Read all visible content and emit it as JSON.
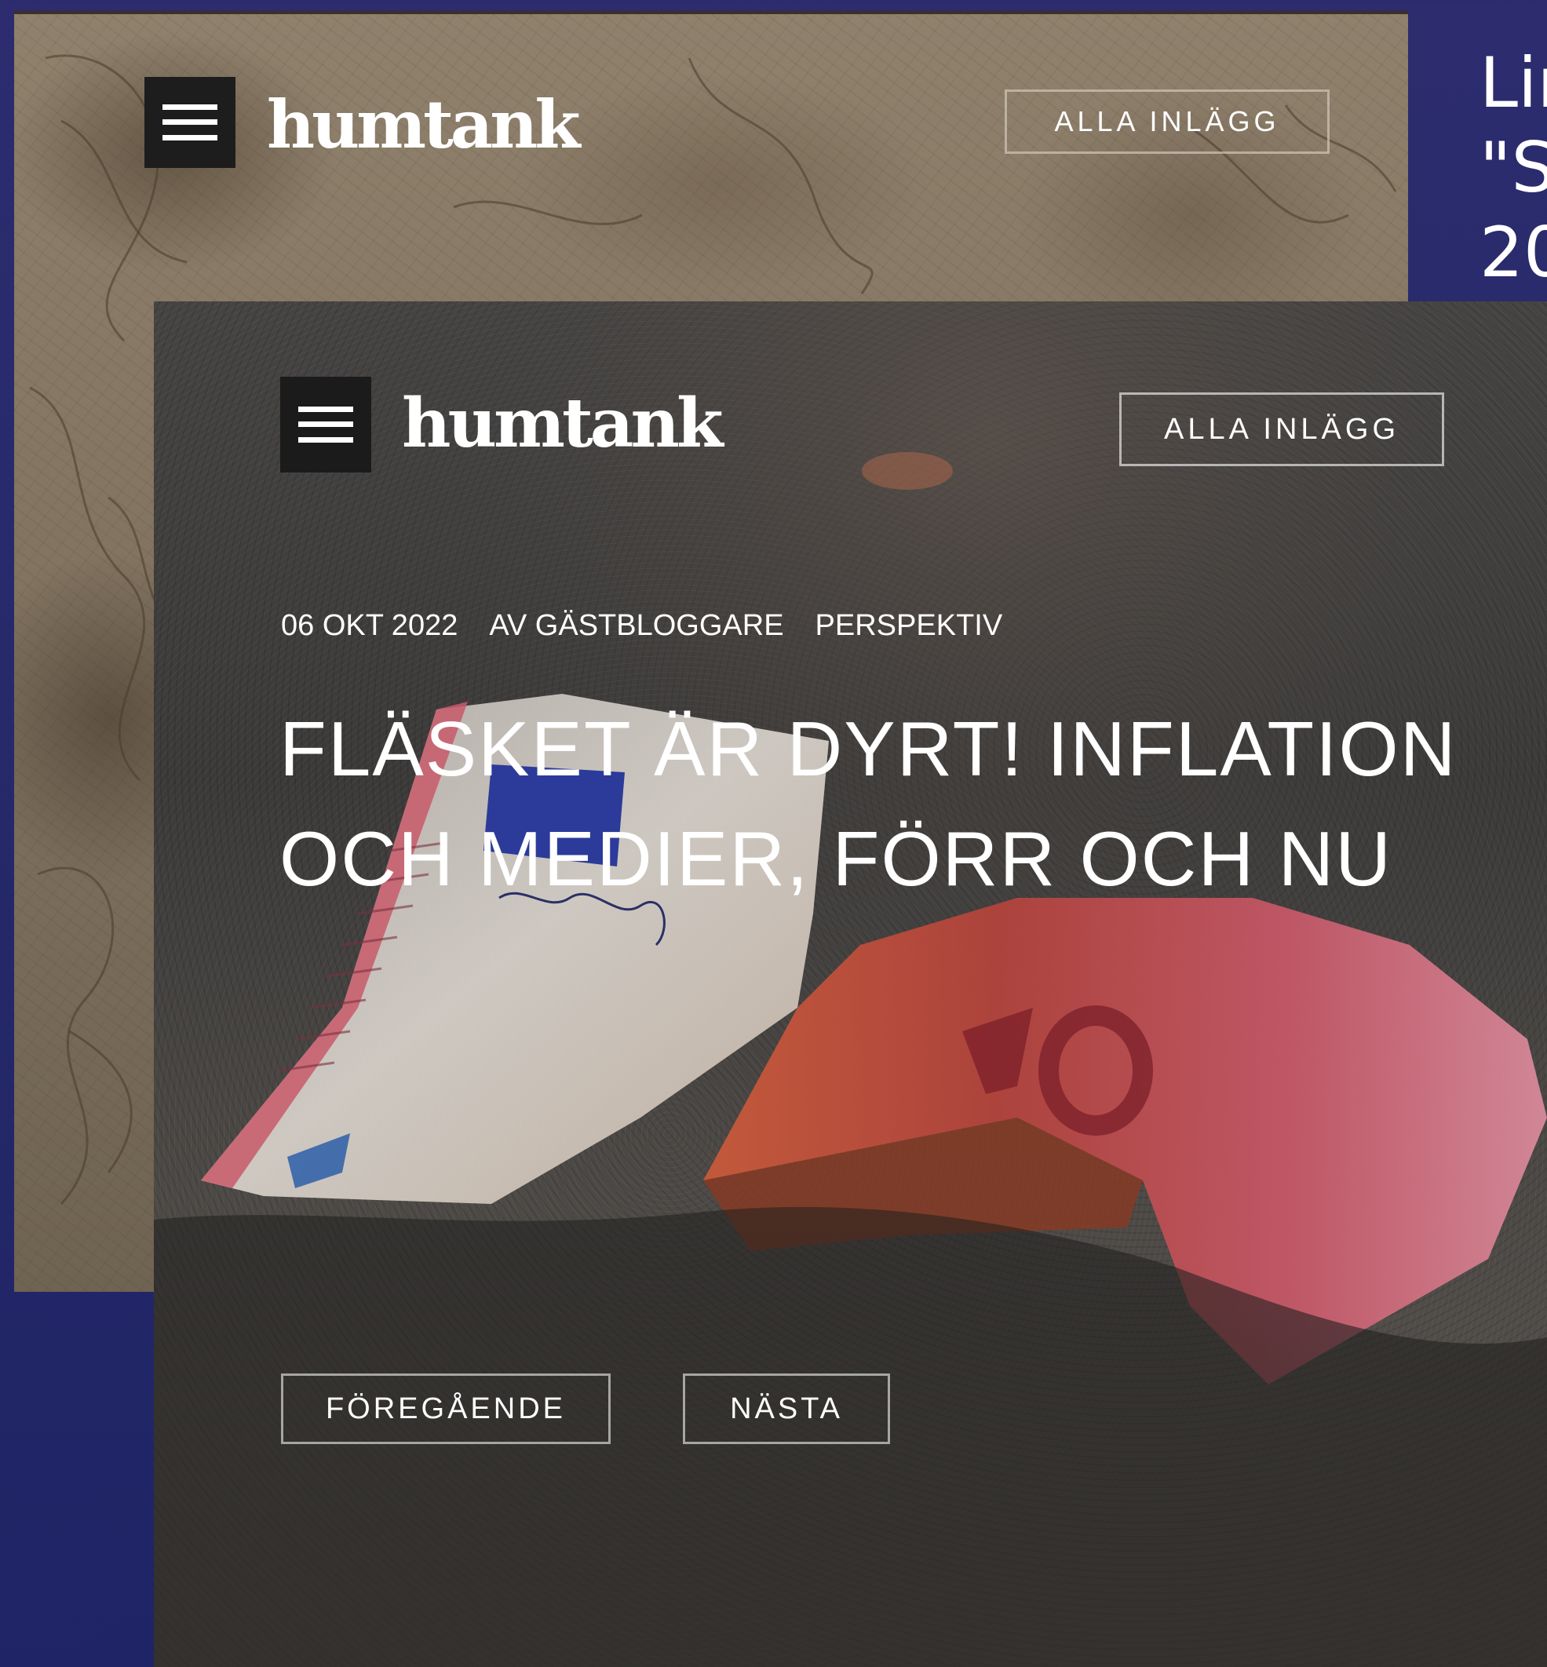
{
  "slide": {
    "lines": [
      "Lin",
      "\"S",
      "20"
    ]
  },
  "back_page": {
    "logo": "humtank",
    "nav_label": "ALLA INLÄGG"
  },
  "front_page": {
    "logo": "humtank",
    "nav_label": "ALLA INLÄGG",
    "meta": {
      "date": "06 OKT 2022",
      "author": "AV GÄSTBLOGGARE",
      "category": "PERSPEKTIV"
    },
    "title_lines": [
      "FLÄSKET ÄR DYRT! INFLATION",
      "OCH MEDIER, FÖRR OCH NU"
    ],
    "prev_label": "FÖREGÅENDE",
    "next_label": "NÄSTA"
  },
  "colors": {
    "slide_background": "#262a6a",
    "menu_button": "#1b1b1b",
    "text": "#ffffff"
  },
  "icons": {
    "menu": "hamburger-menu-icon"
  }
}
